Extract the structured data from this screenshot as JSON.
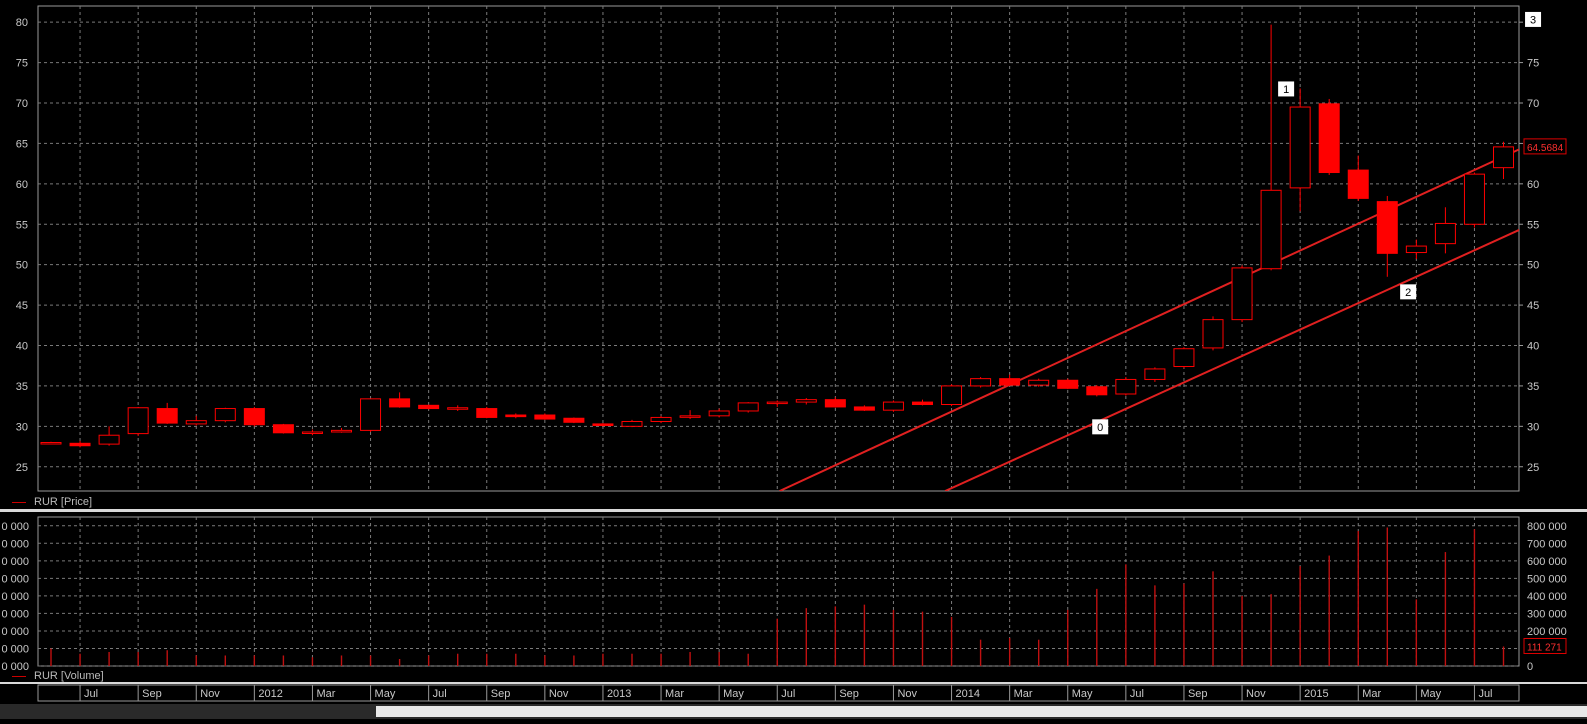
{
  "price_pane": {
    "legend_label": "RUR [Price]",
    "last_value_label": "64.5684",
    "y_ticks": [
      25,
      30,
      35,
      40,
      45,
      50,
      55,
      60,
      65,
      70,
      75,
      80
    ],
    "markers": [
      {
        "label": "0",
        "month_index": 36.1,
        "value": 30.0
      },
      {
        "label": "1",
        "month_index": 42.5,
        "value": 71.8
      },
      {
        "label": "2",
        "month_index": 46.7,
        "value": 46.7
      },
      {
        "label": "3",
        "month_index": 51.0,
        "value": 80.4
      }
    ],
    "channel_lines": [
      {
        "start": {
          "month_index": 25.1,
          "value": 22
        },
        "end": {
          "month_index": 51.6,
          "value": 66
        }
      },
      {
        "start": {
          "month_index": 30.8,
          "value": 22
        },
        "end": {
          "month_index": 51.6,
          "value": 56
        }
      }
    ]
  },
  "volume_pane": {
    "legend_label": "RUR [Volume]",
    "last_value_label": "111 271",
    "right_tick_labels": [
      "0",
      "100 000",
      "200 000",
      "300 000",
      "400 000",
      "500 000",
      "600 000",
      "700 000",
      "800 000"
    ],
    "left_tick_labels": [
      "0 000",
      "0 000",
      "0 000",
      "0 000",
      "0 000",
      "0 000",
      "0 000",
      "0 000",
      "0 000"
    ]
  },
  "x_axis": {
    "labels": [
      {
        "text": "Jul",
        "month_index": 1
      },
      {
        "text": "Sep",
        "month_index": 3
      },
      {
        "text": "Nov",
        "month_index": 5
      },
      {
        "text": "2012",
        "month_index": 7
      },
      {
        "text": "Mar",
        "month_index": 9
      },
      {
        "text": "May",
        "month_index": 11
      },
      {
        "text": "Jul",
        "month_index": 13
      },
      {
        "text": "Sep",
        "month_index": 15
      },
      {
        "text": "Nov",
        "month_index": 17
      },
      {
        "text": "2013",
        "month_index": 19
      },
      {
        "text": "Mar",
        "month_index": 21
      },
      {
        "text": "May",
        "month_index": 23
      },
      {
        "text": "Jul",
        "month_index": 25
      },
      {
        "text": "Sep",
        "month_index": 27
      },
      {
        "text": "Nov",
        "month_index": 29
      },
      {
        "text": "2014",
        "month_index": 31
      },
      {
        "text": "Mar",
        "month_index": 33
      },
      {
        "text": "May",
        "month_index": 35
      },
      {
        "text": "Jul",
        "month_index": 37
      },
      {
        "text": "Sep",
        "month_index": 39
      },
      {
        "text": "Nov",
        "month_index": 41
      },
      {
        "text": "2015",
        "month_index": 43
      },
      {
        "text": "Mar",
        "month_index": 45
      },
      {
        "text": "May",
        "month_index": 47
      },
      {
        "text": "Jul",
        "month_index": 49
      }
    ]
  },
  "colors": {
    "background": "#000000",
    "grid": "#7a7a7a",
    "candle": "#ff0000",
    "channel": "#e02020",
    "axis_text": "#c8c8c8",
    "label_bg": "#ffffff"
  },
  "chart_data": [
    {
      "type": "candlestick",
      "title": "",
      "series_name": "RUR [Price]",
      "x_unit": "month (index 0 = Jun 2011)",
      "ylim": [
        22,
        82
      ],
      "grid": true,
      "candles": [
        {
          "month": "2011-06",
          "open": 27.9,
          "high": 28.1,
          "low": 27.8,
          "close": 28.0
        },
        {
          "month": "2011-07",
          "open": 27.9,
          "high": 28.2,
          "low": 27.4,
          "close": 27.6
        },
        {
          "month": "2011-08",
          "open": 27.8,
          "high": 30.0,
          "low": 27.6,
          "close": 28.9
        },
        {
          "month": "2011-09",
          "open": 29.1,
          "high": 32.4,
          "low": 28.8,
          "close": 32.3
        },
        {
          "month": "2011-10",
          "open": 32.2,
          "high": 32.9,
          "low": 30.3,
          "close": 30.4
        },
        {
          "month": "2011-11",
          "open": 30.3,
          "high": 31.3,
          "low": 30.1,
          "close": 30.7
        },
        {
          "month": "2011-12",
          "open": 30.7,
          "high": 32.3,
          "low": 30.5,
          "close": 32.2
        },
        {
          "month": "2012-01",
          "open": 32.2,
          "high": 32.4,
          "low": 30.0,
          "close": 30.2
        },
        {
          "month": "2012-02",
          "open": 30.2,
          "high": 30.3,
          "low": 29.1,
          "close": 29.2
        },
        {
          "month": "2012-03",
          "open": 29.2,
          "high": 29.6,
          "low": 28.9,
          "close": 29.3
        },
        {
          "month": "2012-04",
          "open": 29.3,
          "high": 29.8,
          "low": 29.2,
          "close": 29.5
        },
        {
          "month": "2012-05",
          "open": 29.5,
          "high": 33.4,
          "low": 29.3,
          "close": 33.4
        },
        {
          "month": "2012-06",
          "open": 33.4,
          "high": 34.2,
          "low": 32.3,
          "close": 32.4
        },
        {
          "month": "2012-07",
          "open": 32.6,
          "high": 32.7,
          "low": 32.1,
          "close": 32.2
        },
        {
          "month": "2012-08",
          "open": 32.2,
          "high": 32.6,
          "low": 31.9,
          "close": 32.3
        },
        {
          "month": "2012-09",
          "open": 32.2,
          "high": 32.4,
          "low": 31.0,
          "close": 31.1
        },
        {
          "month": "2012-10",
          "open": 31.4,
          "high": 31.6,
          "low": 31.0,
          "close": 31.2
        },
        {
          "month": "2012-11",
          "open": 31.4,
          "high": 31.6,
          "low": 30.8,
          "close": 30.9
        },
        {
          "month": "2012-12",
          "open": 31.0,
          "high": 31.1,
          "low": 30.4,
          "close": 30.5
        },
        {
          "month": "2013-01",
          "open": 30.3,
          "high": 30.4,
          "low": 30.0,
          "close": 30.1
        },
        {
          "month": "2013-02",
          "open": 30.0,
          "high": 30.8,
          "low": 29.9,
          "close": 30.6
        },
        {
          "month": "2013-03",
          "open": 30.6,
          "high": 31.3,
          "low": 30.4,
          "close": 31.1
        },
        {
          "month": "2013-04",
          "open": 31.2,
          "high": 32.0,
          "low": 30.9,
          "close": 31.3
        },
        {
          "month": "2013-05",
          "open": 31.3,
          "high": 32.2,
          "low": 31.1,
          "close": 31.9
        },
        {
          "month": "2013-06",
          "open": 31.9,
          "high": 33.0,
          "low": 31.7,
          "close": 32.9
        },
        {
          "month": "2013-07",
          "open": 32.9,
          "high": 33.2,
          "low": 32.4,
          "close": 33.0
        },
        {
          "month": "2013-08",
          "open": 33.0,
          "high": 33.5,
          "low": 32.7,
          "close": 33.3
        },
        {
          "month": "2013-09",
          "open": 33.3,
          "high": 33.6,
          "low": 32.3,
          "close": 32.4
        },
        {
          "month": "2013-10",
          "open": 32.4,
          "high": 32.6,
          "low": 31.9,
          "close": 32.0
        },
        {
          "month": "2013-11",
          "open": 32.0,
          "high": 33.2,
          "low": 31.8,
          "close": 33.0
        },
        {
          "month": "2013-12",
          "open": 33.0,
          "high": 33.3,
          "low": 32.6,
          "close": 32.7
        },
        {
          "month": "2014-01",
          "open": 32.7,
          "high": 35.2,
          "low": 32.5,
          "close": 35.0
        },
        {
          "month": "2014-02",
          "open": 35.0,
          "high": 36.1,
          "low": 34.8,
          "close": 35.9
        },
        {
          "month": "2014-03",
          "open": 35.9,
          "high": 36.4,
          "low": 35.0,
          "close": 35.1
        },
        {
          "month": "2014-04",
          "open": 35.1,
          "high": 35.9,
          "low": 34.9,
          "close": 35.7
        },
        {
          "month": "2014-05",
          "open": 35.7,
          "high": 35.9,
          "low": 34.6,
          "close": 34.7
        },
        {
          "month": "2014-06",
          "open": 34.9,
          "high": 35.1,
          "low": 33.7,
          "close": 33.9
        },
        {
          "month": "2014-07",
          "open": 34.0,
          "high": 36.1,
          "low": 33.8,
          "close": 35.8
        },
        {
          "month": "2014-08",
          "open": 35.8,
          "high": 37.3,
          "low": 35.5,
          "close": 37.1
        },
        {
          "month": "2014-09",
          "open": 37.4,
          "high": 39.8,
          "low": 37.2,
          "close": 39.6
        },
        {
          "month": "2014-10",
          "open": 39.7,
          "high": 43.6,
          "low": 39.4,
          "close": 43.2
        },
        {
          "month": "2014-11",
          "open": 43.2,
          "high": 49.9,
          "low": 42.9,
          "close": 49.6
        },
        {
          "month": "2014-12",
          "open": 49.5,
          "high": 79.7,
          "low": 49.3,
          "close": 59.2
        },
        {
          "month": "2015-01",
          "open": 59.5,
          "high": 71.8,
          "low": 56.6,
          "close": 69.5
        },
        {
          "month": "2015-02",
          "open": 69.9,
          "high": 70.5,
          "low": 61.1,
          "close": 61.4
        },
        {
          "month": "2015-03",
          "open": 61.7,
          "high": 63.5,
          "low": 57.9,
          "close": 58.2
        },
        {
          "month": "2015-04",
          "open": 57.8,
          "high": 58.5,
          "low": 48.5,
          "close": 51.4
        },
        {
          "month": "2015-05",
          "open": 51.5,
          "high": 53.1,
          "low": 50.7,
          "close": 52.3
        },
        {
          "month": "2015-06",
          "open": 52.6,
          "high": 57.1,
          "low": 51.4,
          "close": 55.1
        },
        {
          "month": "2015-07",
          "open": 55.0,
          "high": 61.4,
          "low": 54.6,
          "close": 61.2
        },
        {
          "month": "2015-08",
          "open": 62.0,
          "high": 65.2,
          "low": 60.6,
          "close": 64.57
        }
      ]
    },
    {
      "type": "bar",
      "title": "",
      "series_name": "RUR [Volume]",
      "ylim": [
        0,
        850000
      ],
      "grid": true,
      "months": [
        "2011-06",
        "2011-07",
        "2011-08",
        "2011-09",
        "2011-10",
        "2011-11",
        "2011-12",
        "2012-01",
        "2012-02",
        "2012-03",
        "2012-04",
        "2012-05",
        "2012-06",
        "2012-07",
        "2012-08",
        "2012-09",
        "2012-10",
        "2012-11",
        "2012-12",
        "2013-01",
        "2013-02",
        "2013-03",
        "2013-04",
        "2013-05",
        "2013-06",
        "2013-07",
        "2013-08",
        "2013-09",
        "2013-10",
        "2013-11",
        "2013-12",
        "2014-01",
        "2014-02",
        "2014-03",
        "2014-04",
        "2014-05",
        "2014-06",
        "2014-07",
        "2014-08",
        "2014-09",
        "2014-10",
        "2014-11",
        "2014-12",
        "2015-01",
        "2015-02",
        "2015-03",
        "2015-04",
        "2015-05",
        "2015-06",
        "2015-07",
        "2015-08"
      ],
      "values": [
        100000,
        70000,
        80000,
        80000,
        90000,
        60000,
        60000,
        60000,
        60000,
        50000,
        60000,
        60000,
        40000,
        60000,
        70000,
        70000,
        70000,
        60000,
        60000,
        70000,
        70000,
        70000,
        80000,
        80000,
        70000,
        270000,
        330000,
        340000,
        350000,
        320000,
        310000,
        280000,
        150000,
        160000,
        150000,
        320000,
        440000,
        580000,
        460000,
        470000,
        540000,
        400000,
        410000,
        570000,
        630000,
        770000,
        790000,
        380000,
        650000,
        780000,
        111271
      ]
    }
  ]
}
